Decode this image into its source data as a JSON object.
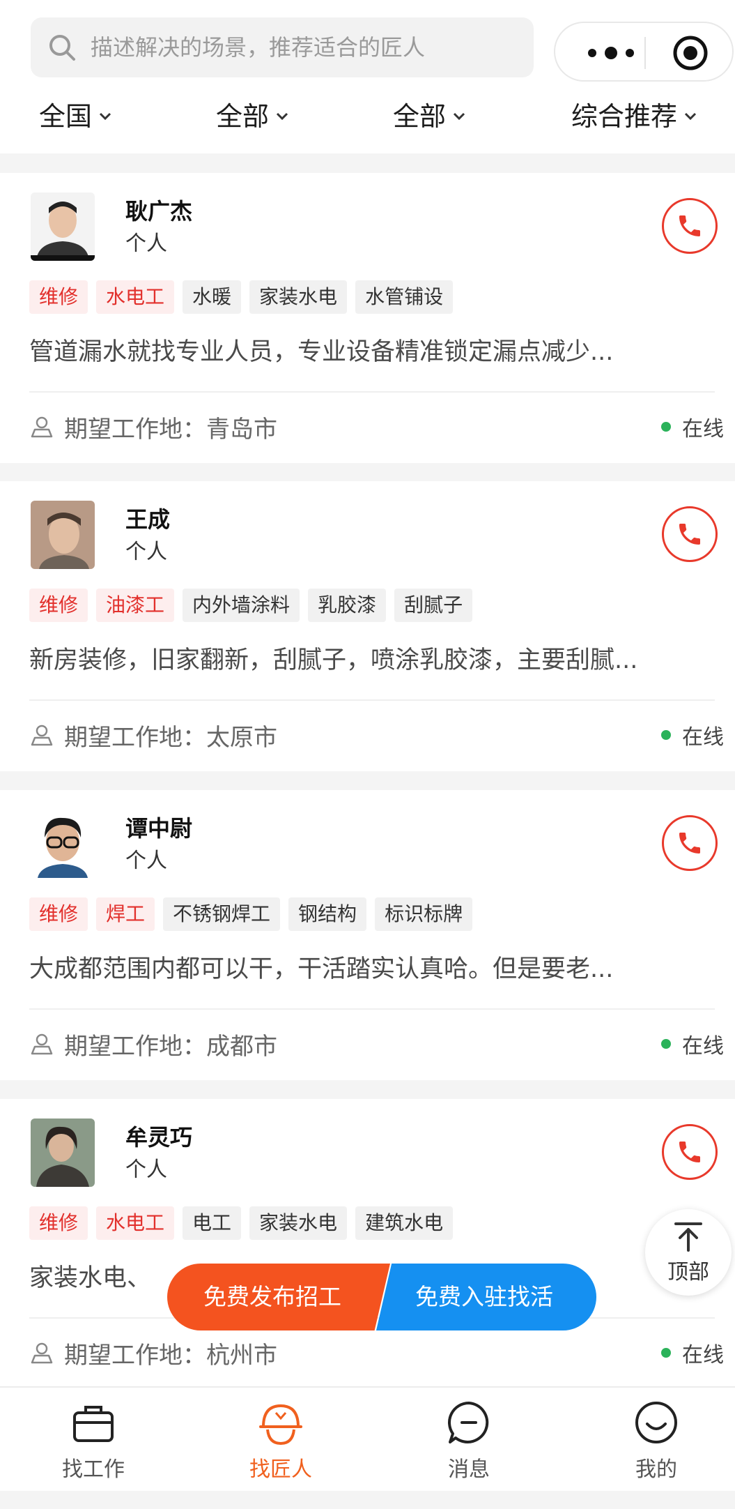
{
  "search": {
    "placeholder": "描述解决的场景，推荐适合的匠人"
  },
  "capsule": {
    "more_icon": "more-dots-icon",
    "target_icon": "target-icon"
  },
  "filters": [
    {
      "label": "全国"
    },
    {
      "label": "全部"
    },
    {
      "label": "全部"
    },
    {
      "label": "综合推荐"
    }
  ],
  "cards": [
    {
      "name": "耿广杰",
      "type": "个人",
      "tags": [
        {
          "text": "维修",
          "style": "red"
        },
        {
          "text": "水电工",
          "style": "red"
        },
        {
          "text": "水暖"
        },
        {
          "text": "家装水电"
        },
        {
          "text": "水管铺设"
        }
      ],
      "desc": "管道漏水就找专业人员，专业设备精准锁定漏点减少...",
      "location": "期望工作地：青岛市",
      "status": "在线"
    },
    {
      "name": "王成",
      "type": "个人",
      "tags": [
        {
          "text": "维修",
          "style": "red"
        },
        {
          "text": "油漆工",
          "style": "red"
        },
        {
          "text": "内外墙涂料"
        },
        {
          "text": "乳胶漆"
        },
        {
          "text": "刮腻子"
        }
      ],
      "desc": "新房装修，旧家翻新，刮腻子，喷涂乳胶漆，主要刮腻...",
      "location": "期望工作地：太原市",
      "status": "在线"
    },
    {
      "name": "谭中尉",
      "type": "个人",
      "tags": [
        {
          "text": "维修",
          "style": "red"
        },
        {
          "text": "焊工",
          "style": "red"
        },
        {
          "text": "不锈钢焊工"
        },
        {
          "text": "钢结构"
        },
        {
          "text": "标识标牌"
        }
      ],
      "desc": "大成都范围内都可以干，干活踏实认真哈。但是要老...",
      "location": "期望工作地：成都市",
      "status": "在线"
    },
    {
      "name": "牟灵巧",
      "type": "个人",
      "tags": [
        {
          "text": "维修",
          "style": "red"
        },
        {
          "text": "水电工",
          "style": "red"
        },
        {
          "text": "电工"
        },
        {
          "text": "家装水电"
        },
        {
          "text": "建筑水电"
        }
      ],
      "desc": "家装水电、",
      "location": "期望工作地：杭州市",
      "status": "在线"
    }
  ],
  "back_to_top": {
    "label": "顶部"
  },
  "cta": {
    "post_job": "免费发布招工",
    "find_work": "免费入驻找活"
  },
  "tabs": [
    {
      "label": "找工作",
      "icon": "briefcase-icon"
    },
    {
      "label": "找匠人",
      "icon": "helmet-icon",
      "active": true
    },
    {
      "label": "消息",
      "icon": "message-icon"
    },
    {
      "label": "我的",
      "icon": "smile-icon"
    }
  ],
  "colors": {
    "accent": "#f0601e",
    "call": "#e8392b",
    "tag_red": "#e2302c",
    "online": "#2bb25a",
    "cta_orange": "#f4531f",
    "cta_blue": "#1590f1"
  }
}
